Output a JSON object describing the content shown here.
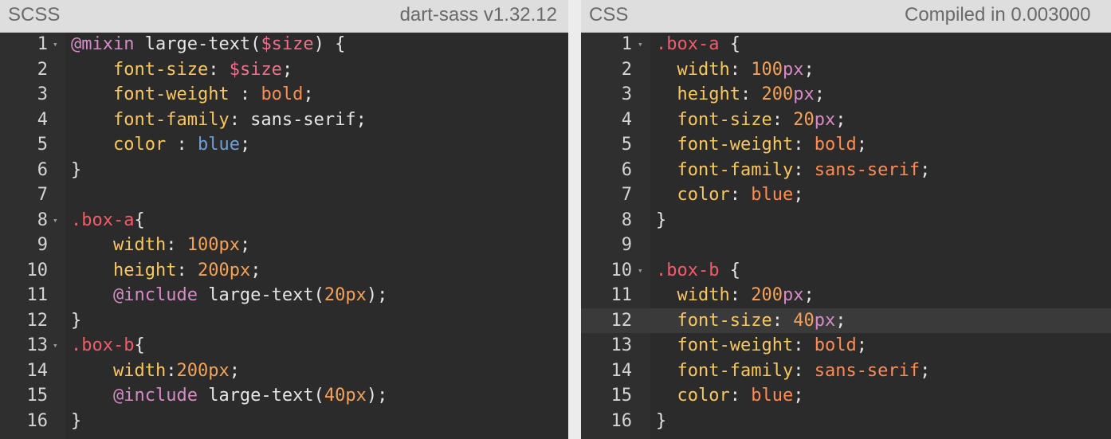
{
  "panes": {
    "scss": {
      "title": "SCSS",
      "info": "dart-sass v1.32.12",
      "lines": [
        {
          "n": "1",
          "fold": true,
          "tokens": [
            [
              "kw",
              "@mixin"
            ],
            [
              "plain",
              " large-text("
            ],
            [
              "var",
              "$size"
            ],
            [
              "plain",
              ") {"
            ]
          ]
        },
        {
          "n": "2",
          "fold": false,
          "tokens": [
            [
              "plain",
              "    "
            ],
            [
              "prop",
              "font-size"
            ],
            [
              "plain",
              ": "
            ],
            [
              "var",
              "$size"
            ],
            [
              "plain",
              ";"
            ]
          ]
        },
        {
          "n": "3",
          "fold": false,
          "tokens": [
            [
              "plain",
              "    "
            ],
            [
              "prop",
              "font-weight"
            ],
            [
              "plain",
              " : "
            ],
            [
              "ident",
              "bold"
            ],
            [
              "plain",
              ";"
            ]
          ]
        },
        {
          "n": "4",
          "fold": false,
          "tokens": [
            [
              "plain",
              "    "
            ],
            [
              "prop",
              "font-family"
            ],
            [
              "plain",
              ": sans-serif;"
            ]
          ]
        },
        {
          "n": "5",
          "fold": false,
          "tokens": [
            [
              "plain",
              "    "
            ],
            [
              "prop",
              "color"
            ],
            [
              "plain",
              " : "
            ],
            [
              "blue",
              "blue"
            ],
            [
              "plain",
              ";"
            ]
          ]
        },
        {
          "n": "6",
          "fold": false,
          "tokens": [
            [
              "plain",
              "}"
            ]
          ]
        },
        {
          "n": "7",
          "fold": false,
          "tokens": []
        },
        {
          "n": "8",
          "fold": true,
          "tokens": [
            [
              "sel",
              ".box-a"
            ],
            [
              "plain",
              "{"
            ]
          ]
        },
        {
          "n": "9",
          "fold": false,
          "tokens": [
            [
              "plain",
              "    "
            ],
            [
              "prop",
              "width"
            ],
            [
              "plain",
              ": "
            ],
            [
              "num",
              "100px"
            ],
            [
              "plain",
              ";"
            ]
          ]
        },
        {
          "n": "10",
          "fold": false,
          "tokens": [
            [
              "plain",
              "    "
            ],
            [
              "prop",
              "height"
            ],
            [
              "plain",
              ": "
            ],
            [
              "num",
              "200px"
            ],
            [
              "plain",
              ";"
            ]
          ]
        },
        {
          "n": "11",
          "fold": false,
          "tokens": [
            [
              "plain",
              "    "
            ],
            [
              "kw",
              "@include"
            ],
            [
              "plain",
              " large-text("
            ],
            [
              "num",
              "20px"
            ],
            [
              "plain",
              ");"
            ]
          ]
        },
        {
          "n": "12",
          "fold": false,
          "tokens": [
            [
              "plain",
              "}"
            ]
          ]
        },
        {
          "n": "13",
          "fold": true,
          "tokens": [
            [
              "sel",
              ".box-b"
            ],
            [
              "plain",
              "{"
            ]
          ]
        },
        {
          "n": "14",
          "fold": false,
          "tokens": [
            [
              "plain",
              "    "
            ],
            [
              "prop",
              "width"
            ],
            [
              "plain",
              ":"
            ],
            [
              "num",
              "200px"
            ],
            [
              "plain",
              ";"
            ]
          ]
        },
        {
          "n": "15",
          "fold": false,
          "tokens": [
            [
              "plain",
              "    "
            ],
            [
              "kw",
              "@include"
            ],
            [
              "plain",
              " large-text("
            ],
            [
              "num",
              "40px"
            ],
            [
              "plain",
              ");"
            ]
          ]
        },
        {
          "n": "16",
          "fold": false,
          "tokens": [
            [
              "plain",
              "}"
            ]
          ]
        }
      ]
    },
    "css": {
      "title": "CSS",
      "info": "Compiled in 0.003000",
      "active_line": "12",
      "lines": [
        {
          "n": "1",
          "fold": true,
          "tokens": [
            [
              "sel",
              ".box-a"
            ],
            [
              "plain",
              " {"
            ]
          ]
        },
        {
          "n": "2",
          "fold": false,
          "tokens": [
            [
              "plain",
              "  "
            ],
            [
              "prop",
              "width"
            ],
            [
              "plain",
              ": "
            ],
            [
              "num",
              "100"
            ],
            [
              "unit",
              "px"
            ],
            [
              "plain",
              ";"
            ]
          ]
        },
        {
          "n": "3",
          "fold": false,
          "tokens": [
            [
              "plain",
              "  "
            ],
            [
              "prop",
              "height"
            ],
            [
              "plain",
              ": "
            ],
            [
              "num",
              "200"
            ],
            [
              "unit",
              "px"
            ],
            [
              "plain",
              ";"
            ]
          ]
        },
        {
          "n": "4",
          "fold": false,
          "tokens": [
            [
              "plain",
              "  "
            ],
            [
              "prop",
              "font-size"
            ],
            [
              "plain",
              ": "
            ],
            [
              "num",
              "20"
            ],
            [
              "unit",
              "px"
            ],
            [
              "plain",
              ";"
            ]
          ]
        },
        {
          "n": "5",
          "fold": false,
          "tokens": [
            [
              "plain",
              "  "
            ],
            [
              "prop",
              "font-weight"
            ],
            [
              "plain",
              ": "
            ],
            [
              "ident",
              "bold"
            ],
            [
              "plain",
              ";"
            ]
          ]
        },
        {
          "n": "6",
          "fold": false,
          "tokens": [
            [
              "plain",
              "  "
            ],
            [
              "prop",
              "font-family"
            ],
            [
              "plain",
              ": "
            ],
            [
              "ident",
              "sans-serif"
            ],
            [
              "plain",
              ";"
            ]
          ]
        },
        {
          "n": "7",
          "fold": false,
          "tokens": [
            [
              "plain",
              "  "
            ],
            [
              "prop",
              "color"
            ],
            [
              "plain",
              ": "
            ],
            [
              "ident",
              "blue"
            ],
            [
              "plain",
              ";"
            ]
          ]
        },
        {
          "n": "8",
          "fold": false,
          "tokens": [
            [
              "plain",
              "}"
            ]
          ]
        },
        {
          "n": "9",
          "fold": false,
          "tokens": []
        },
        {
          "n": "10",
          "fold": true,
          "tokens": [
            [
              "sel",
              ".box-b"
            ],
            [
              "plain",
              " {"
            ]
          ]
        },
        {
          "n": "11",
          "fold": false,
          "tokens": [
            [
              "plain",
              "  "
            ],
            [
              "prop",
              "width"
            ],
            [
              "plain",
              ": "
            ],
            [
              "num",
              "200"
            ],
            [
              "unit",
              "px"
            ],
            [
              "plain",
              ";"
            ]
          ]
        },
        {
          "n": "12",
          "fold": false,
          "tokens": [
            [
              "plain",
              "  "
            ],
            [
              "prop",
              "font-size"
            ],
            [
              "plain",
              ": "
            ],
            [
              "num",
              "40"
            ],
            [
              "unit",
              "px"
            ],
            [
              "plain",
              ";"
            ]
          ]
        },
        {
          "n": "13",
          "fold": false,
          "tokens": [
            [
              "plain",
              "  "
            ],
            [
              "prop",
              "font-weight"
            ],
            [
              "plain",
              ": "
            ],
            [
              "ident",
              "bold"
            ],
            [
              "plain",
              ";"
            ]
          ]
        },
        {
          "n": "14",
          "fold": false,
          "tokens": [
            [
              "plain",
              "  "
            ],
            [
              "prop",
              "font-family"
            ],
            [
              "plain",
              ": "
            ],
            [
              "ident",
              "sans-serif"
            ],
            [
              "plain",
              ";"
            ]
          ]
        },
        {
          "n": "15",
          "fold": false,
          "tokens": [
            [
              "plain",
              "  "
            ],
            [
              "prop",
              "color"
            ],
            [
              "plain",
              ": "
            ],
            [
              "ident",
              "blue"
            ],
            [
              "plain",
              ";"
            ]
          ]
        },
        {
          "n": "16",
          "fold": false,
          "tokens": [
            [
              "plain",
              "}"
            ]
          ]
        }
      ]
    }
  },
  "icons": {
    "fold": "fold-arrow-icon"
  },
  "colors": {
    "editor_bg": "#2b2b2b",
    "header_bg": "#dedede",
    "selector": "#f25c6a",
    "keyword": "#d58cc4",
    "property": "#f8c760",
    "number": "#f5a259"
  }
}
